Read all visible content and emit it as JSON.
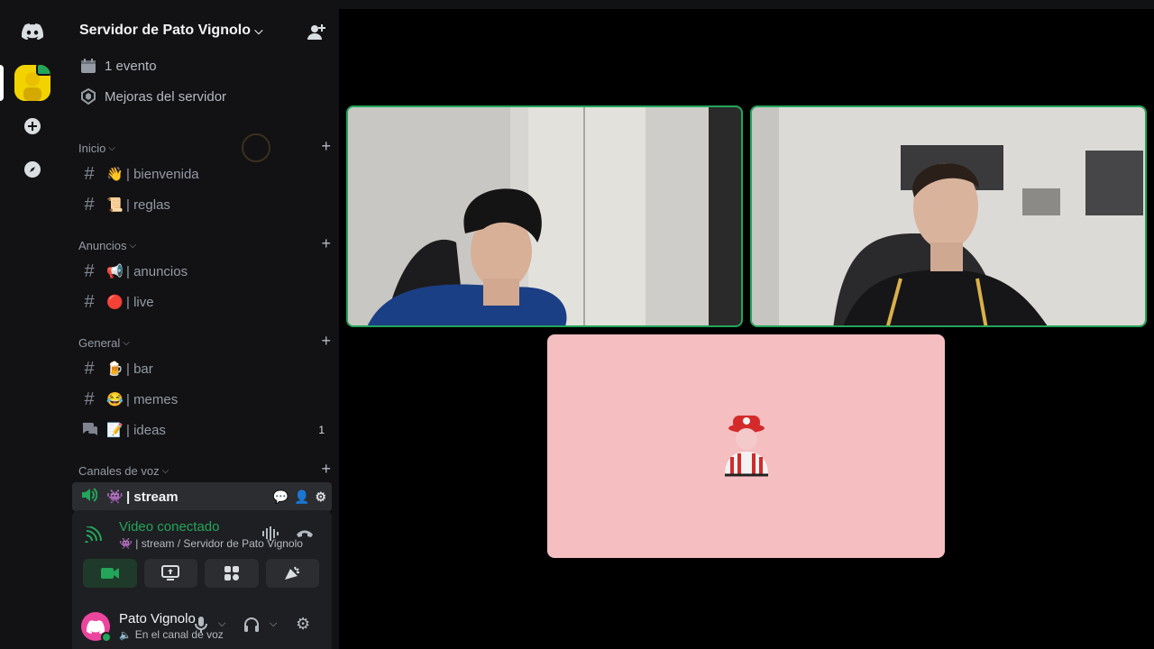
{
  "server": {
    "name": "Servidor de Pato Vignolo"
  },
  "top_items": {
    "events": "1 evento",
    "boosts": "Mejoras del servidor"
  },
  "categories": [
    {
      "name": "Inicio",
      "channels": [
        {
          "emoji": "👋",
          "name": "| bienvenida"
        },
        {
          "emoji": "📜",
          "name": "| reglas"
        }
      ]
    },
    {
      "name": "Anuncios",
      "channels": [
        {
          "emoji": "📢",
          "name": "| anuncios"
        },
        {
          "emoji": "🔴",
          "name": "| live"
        }
      ]
    },
    {
      "name": "General",
      "channels": [
        {
          "emoji": "🍺",
          "name": "| bar"
        },
        {
          "emoji": "😂",
          "name": "| memes"
        },
        {
          "emoji": "📝",
          "name": "| ideas",
          "count": "1"
        }
      ]
    },
    {
      "name": "Canales de voz",
      "channels": [
        {
          "emoji": "👾",
          "name": "| stream"
        }
      ]
    }
  ],
  "voice": {
    "title": "Video conectado",
    "subtitle": "| stream / Servidor de Pato Vignolo"
  },
  "user": {
    "name": "Pato Vignolo",
    "status": "En el canal de voz"
  },
  "colors": {
    "accent_green": "#23a55a",
    "sidebar_bg": "#121214",
    "panel_bg": "#1e1f22",
    "avatar_tile_bg": "#f5bec1"
  },
  "icons": [
    "discord-logo-icon",
    "calendar-icon",
    "boost-shield-icon",
    "hash-icon",
    "forum-icon",
    "speaker-icon",
    "chat-bubble-icon",
    "add-member-icon",
    "gear-icon",
    "camera-icon",
    "screen-share-icon",
    "activities-icon",
    "soundboard-icon",
    "microphone-icon",
    "headphones-icon",
    "hang-up-icon"
  ]
}
